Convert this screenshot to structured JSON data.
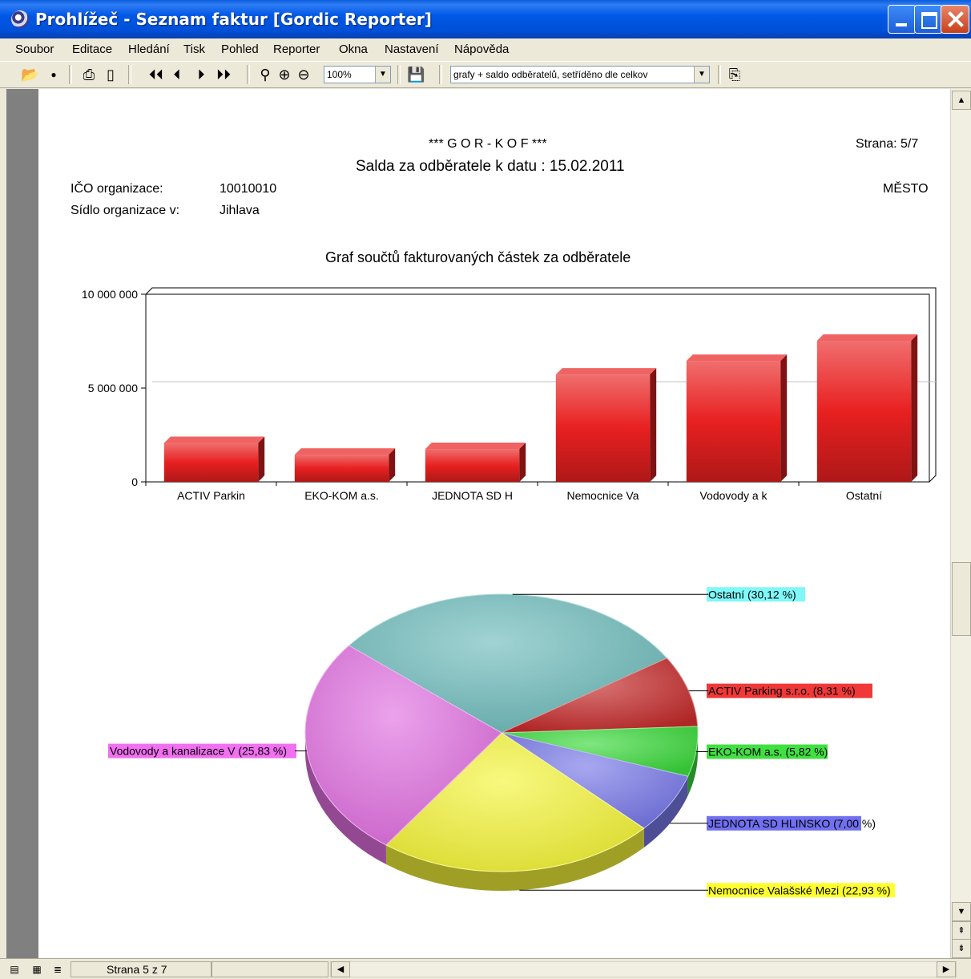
{
  "window": {
    "title": "Prohlížeč - Seznam faktur [Gordic Reporter]"
  },
  "menu": [
    "Soubor",
    "Editace",
    "Hledání",
    "Tisk",
    "Pohled",
    "Reporter",
    "Okna",
    "Nastavení",
    "Nápověda"
  ],
  "toolbar": {
    "zoom_value": "100%",
    "report_value": "grafy + saldo odběratelů, setříděno dle celkov"
  },
  "report": {
    "company": "*** G O R - K O F ***",
    "page_label": "Strana: 5/7",
    "heading": "Salda za odběratele k datu : 15.02.2011",
    "ico_label": "IČO organizace:",
    "ico_value": "10010010",
    "seat_label": "Sídlo organizace v:",
    "seat_value": "Jihlava",
    "city": "MĚSTO"
  },
  "chart_data": [
    {
      "type": "bar",
      "title": "Graf součtů fakturovaných  částek za odběratele",
      "categories": [
        "ACTIV Parkin",
        "EKO-KOM a.s.",
        "JEDNOTA SD H",
        "Nemocnice Va",
        "Vodovody a k",
        "Ostatní"
      ],
      "values": [
        2070000,
        1450000,
        1750000,
        5720000,
        6450000,
        7520000
      ],
      "ylim": [
        0,
        10000000
      ],
      "yticks": [
        0,
        5000000,
        10000000
      ],
      "ytick_labels": [
        "0",
        "5 000 000",
        "10 000 000"
      ],
      "grid": true,
      "bar_color": "#e82020"
    },
    {
      "type": "pie",
      "slices": [
        {
          "label": "Ostatní (30,12 %)",
          "value": 30.12,
          "color": "#6fbcbc",
          "label_bg": "#7ff8f8"
        },
        {
          "label": "ACTIV Parking s.r.o. (8,31 %)",
          "value": 8.31,
          "color": "#c42a2a",
          "label_bg": "#f03838"
        },
        {
          "label": "EKO-KOM a.s. (5,82 %)",
          "value": 5.82,
          "color": "#3ad83a",
          "label_bg": "#40e040"
        },
        {
          "label": "JEDNOTA SD HLINSKO (7,00 %)",
          "value": 7.0,
          "color": "#7878e8",
          "label_bg": "#7070f0"
        },
        {
          "label": "Nemocnice Valašské Mezi (22,93 %)",
          "value": 22.93,
          "color": "#f4f43a",
          "label_bg": "#ffff30"
        },
        {
          "label": "Vodovody a kanalizace V (25,83 %)",
          "value": 25.83,
          "color": "#e070e0",
          "label_bg": "#f070f0"
        }
      ]
    }
  ],
  "status": {
    "page_text": "Strana 5 z 7"
  }
}
